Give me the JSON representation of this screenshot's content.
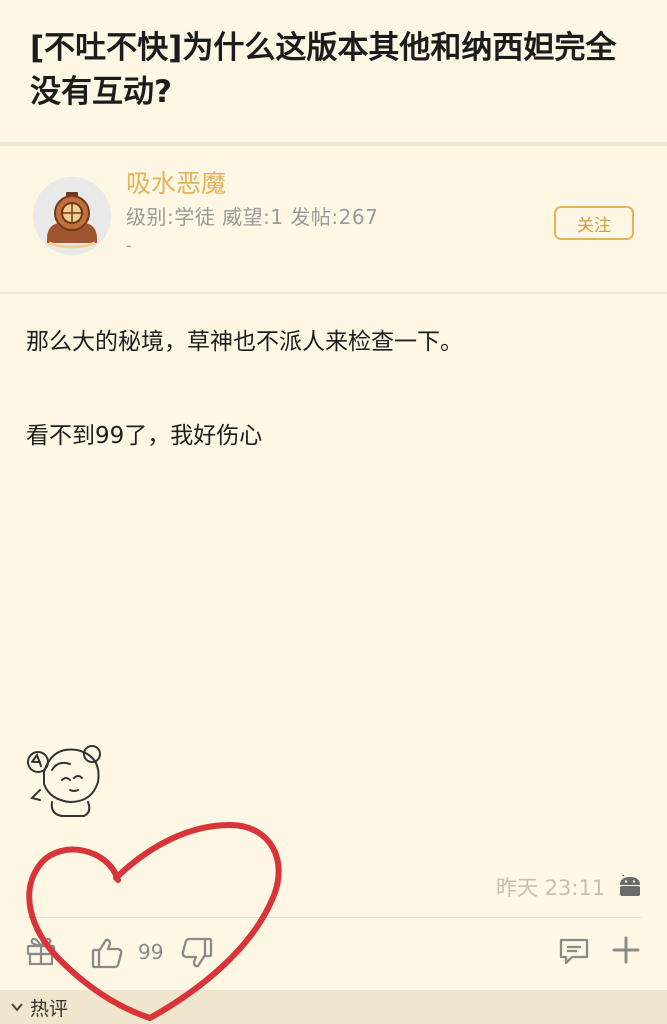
{
  "post": {
    "title": "[不吐不快]为什么这版本其他和纳西妲完全没有互动?",
    "body": [
      "那么大的秘境，草神也不派人来检查一下。",
      "看不到99了，我好伤心"
    ],
    "timestamp": "昨天 23:11"
  },
  "author": {
    "name": "吸水恶魔",
    "meta": "级别:学徒 威望:1 发帖:267",
    "extra": "-",
    "follow_label": "关注"
  },
  "actions": {
    "like_count": "99"
  },
  "tabs": {
    "hot_comments_label": "热评"
  },
  "colors": {
    "background": "#fdf7e4",
    "accent": "#e6b35a",
    "annotation": "#d8343a"
  },
  "icons": [
    "gift-icon",
    "thumbs-up-icon",
    "thumbs-down-icon",
    "comment-icon",
    "plus-icon",
    "android-icon",
    "chevron-down-icon"
  ]
}
